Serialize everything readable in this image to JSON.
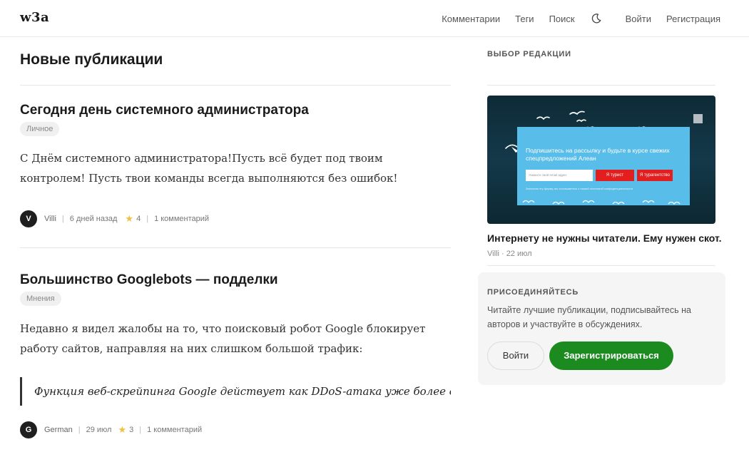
{
  "header": {
    "logo": "w3a",
    "nav": [
      "Комментарии",
      "Теги",
      "Поиск"
    ],
    "login": "Войти",
    "register": "Регистрация",
    "theme_icon": "moon-icon"
  },
  "main": {
    "title": "Новые публикации",
    "posts": [
      {
        "title": "Сегодня день системного администратора",
        "tag": "Личное",
        "excerpt": "С Днём системного администратора!Пусть всё будет под твоим контролем! Пусть твои команды всегда выполняются без ошибок!",
        "avatar": "V",
        "author": "Villi",
        "date": "6 дней назад",
        "rating": "4",
        "comments": "1 комментарий"
      },
      {
        "title": "Большинство Googlebots — подделки",
        "tag": "Мнения",
        "excerpt": "Недавно я видел жалобы на то, что поисковый робот Google блокирует работу сайтов, направляя на них слишком большой трафик:",
        "quote": "Функция веб-скрейпинга Google действует как DDoS-атака уже более двух...",
        "avatar": "G",
        "author": "German",
        "date": "29 июл",
        "rating": "3",
        "comments": "1 комментарий"
      }
    ]
  },
  "sidebar": {
    "editors_heading": "ВЫБОР РЕДАКЦИИ",
    "promo": {
      "text": "Подпишитесь на рассылку и будьте в курсе свежих спецпредложений Алеан",
      "input_placeholder": "Укажите свой email адрес",
      "btn_tourist": "Я турист",
      "btn_agency": "Я турагентство",
      "fine_print": "Заполняя эту форму, вы соглашаетесь с нашей политикой конфиденциальности"
    },
    "featured_title": "Интернету не нужны читатели. Ему нужен скот.",
    "featured_meta": "Villi · 22 июл",
    "join": {
      "heading": "ПРИСОЕДИНЯЙТЕСЬ",
      "text": "Читайте лучшие публикации, подписывайтесь на авторов и участвуйте в обсуждениях.",
      "login": "Войти",
      "register": "Зарегистрироваться"
    }
  }
}
